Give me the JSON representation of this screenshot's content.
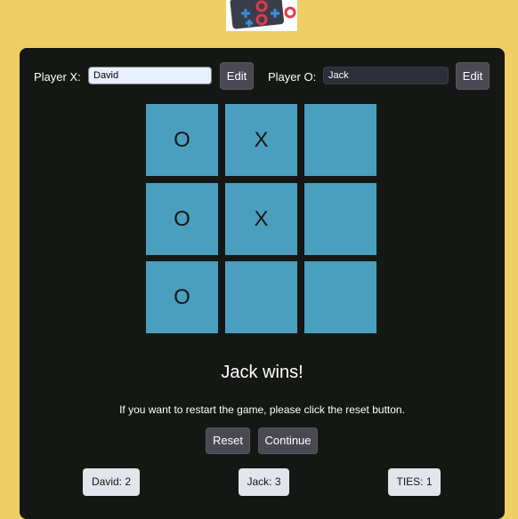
{
  "header": {
    "logo_icon": "tic-tac-toe-logo-icon"
  },
  "players": {
    "x_label": "Player X:",
    "x_name": "David",
    "o_label": "Player O:",
    "o_name": "Jack",
    "edit_label": "Edit"
  },
  "board": {
    "cells": [
      "O",
      "X",
      "",
      "O",
      "X",
      "",
      "O",
      "",
      ""
    ]
  },
  "status": {
    "result": "Jack wins!",
    "hint": "If you want to restart the game, please click the reset button."
  },
  "controls": {
    "reset_label": "Reset",
    "continue_label": "Continue"
  },
  "scores": {
    "x": "David: 2",
    "o": "Jack: 3",
    "ties": "TIES: 1"
  },
  "colors": {
    "page_bg": "#eecf64",
    "panel_bg": "#141713",
    "cell_bg": "#4a9fbf",
    "button_bg": "#4a4853"
  }
}
